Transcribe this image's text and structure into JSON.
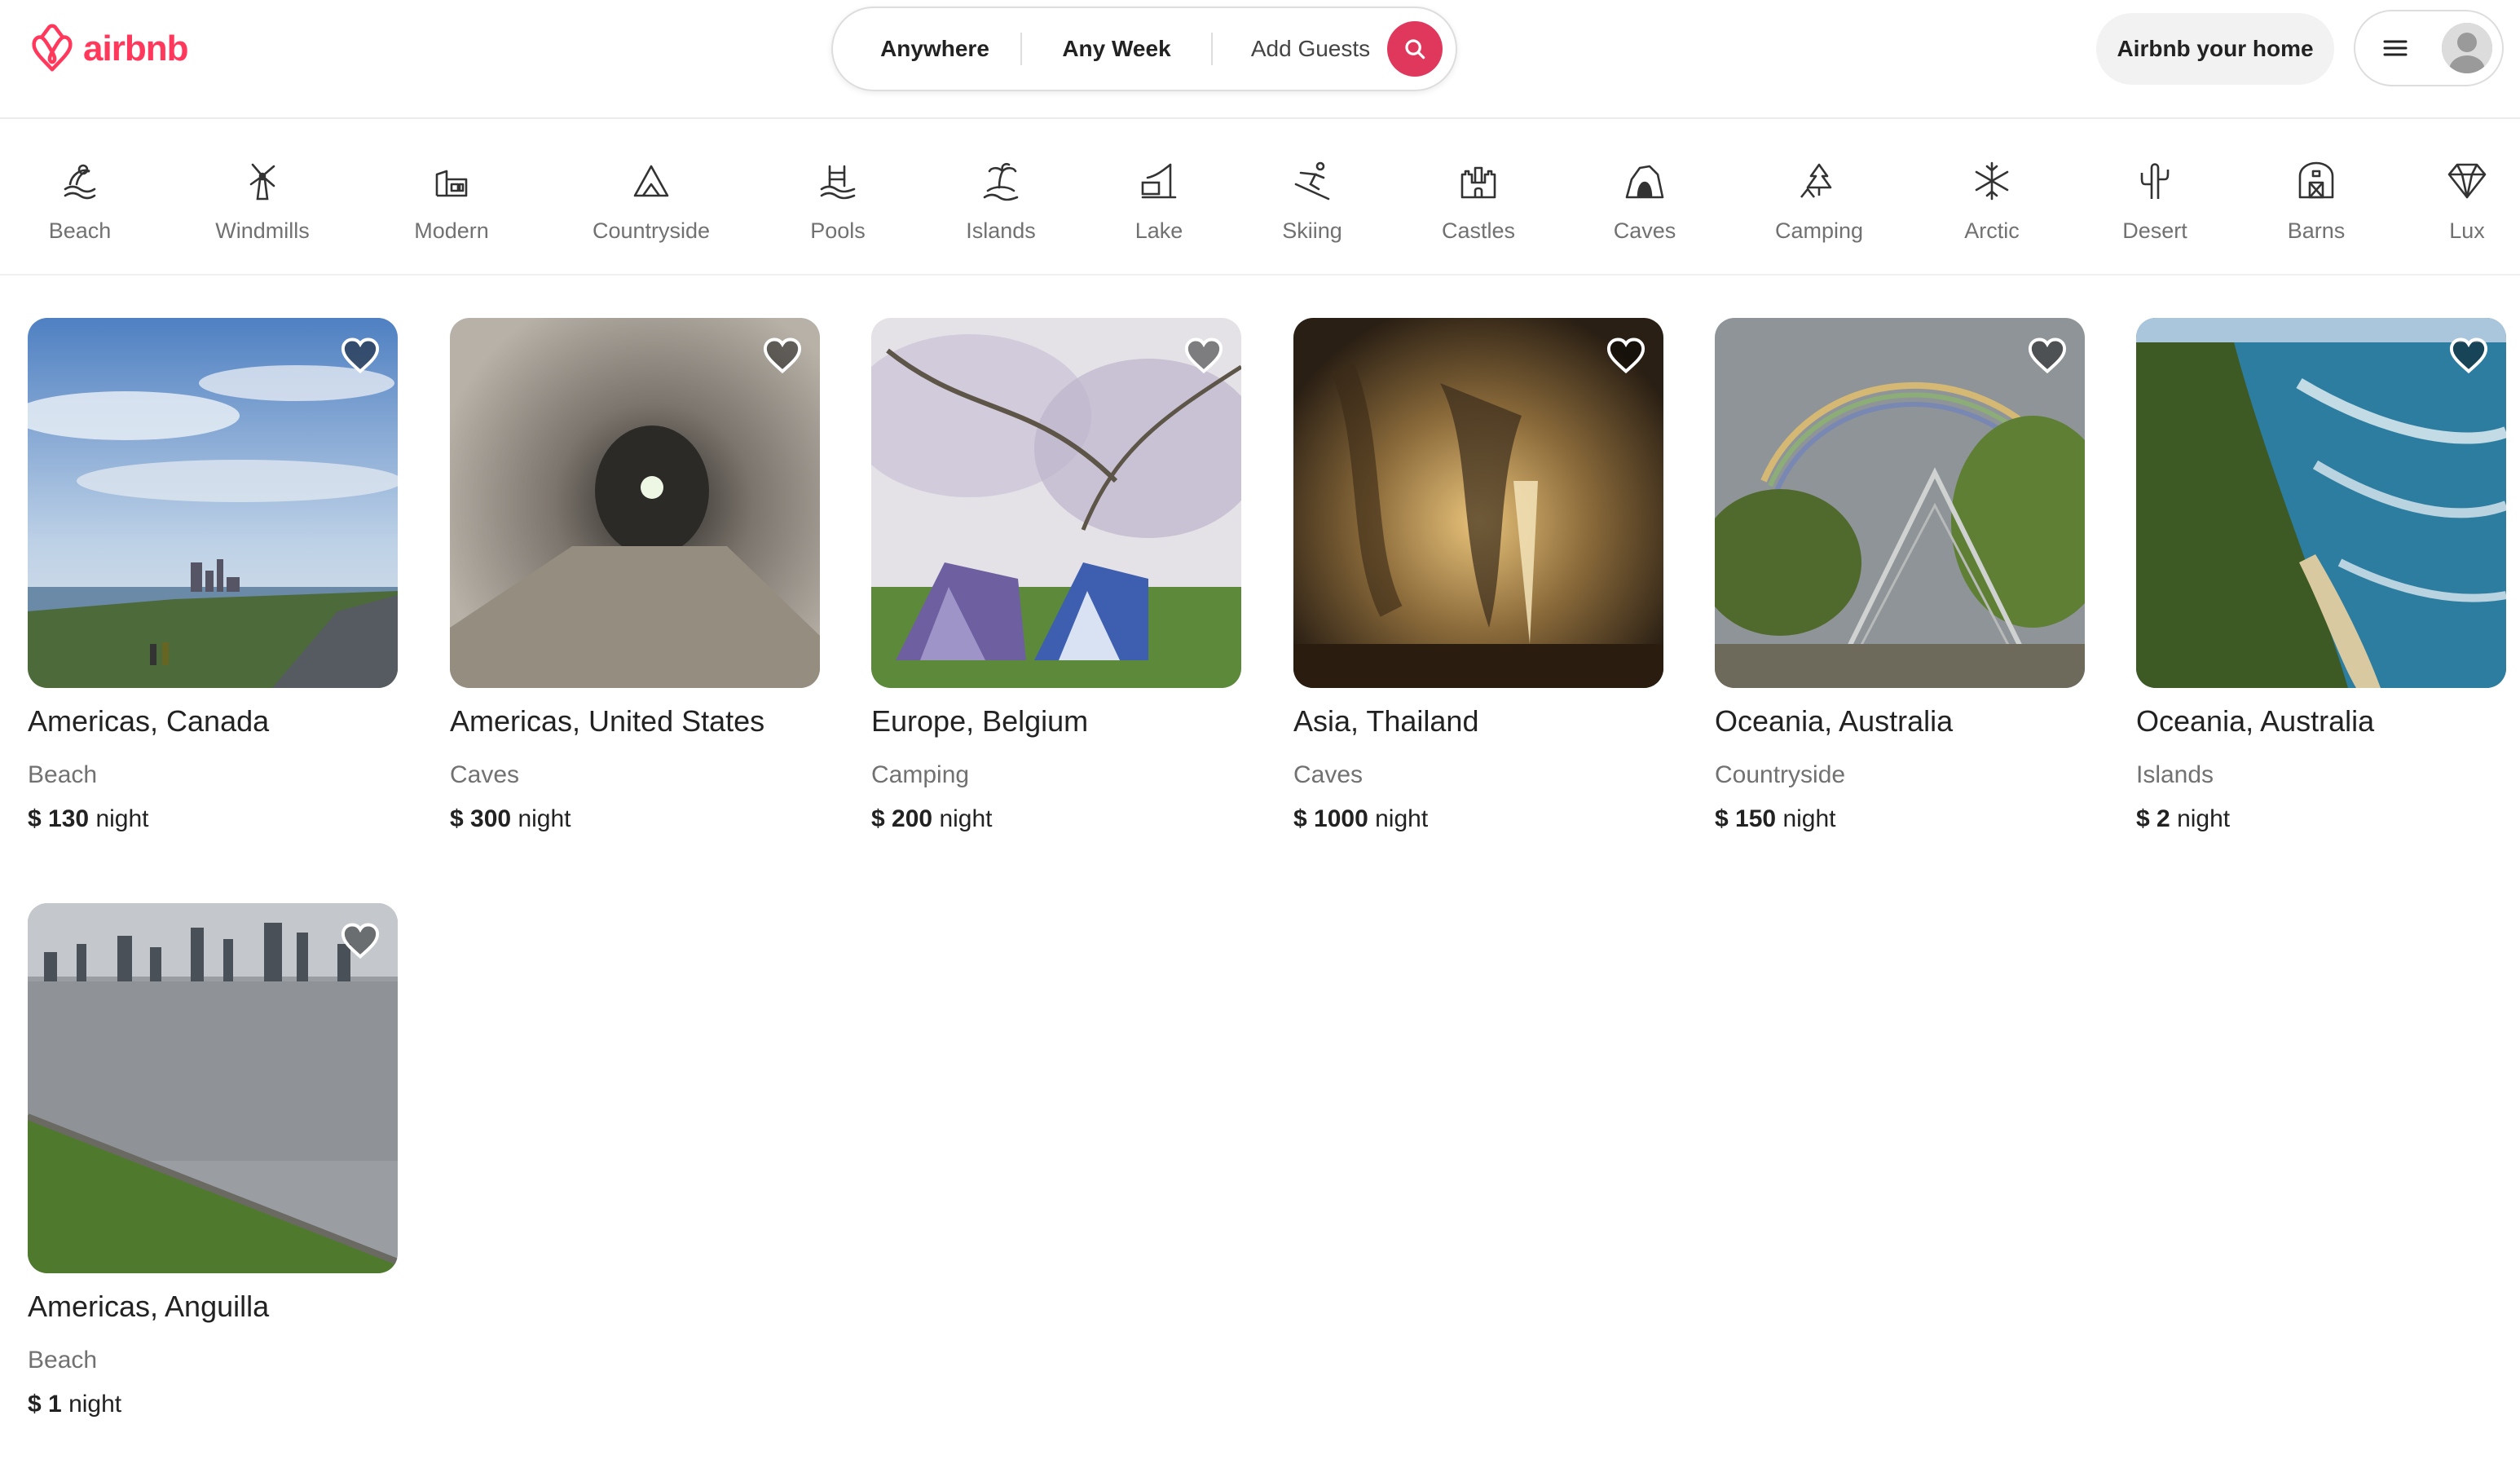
{
  "header": {
    "logo_text": "airbnb",
    "search": {
      "where": "Anywhere",
      "when": "Any Week",
      "who": "Add Guests"
    },
    "host_label": "Airbnb your home"
  },
  "colors": {
    "brand": "#FF385C",
    "search_button": "#E0385C",
    "muted_text": "#717171"
  },
  "categories": [
    {
      "label": "Beach",
      "icon": "beach-icon"
    },
    {
      "label": "Windmills",
      "icon": "windmill-icon"
    },
    {
      "label": "Modern",
      "icon": "modern-house-icon"
    },
    {
      "label": "Countryside",
      "icon": "countryside-icon"
    },
    {
      "label": "Pools",
      "icon": "pool-icon"
    },
    {
      "label": "Islands",
      "icon": "island-icon"
    },
    {
      "label": "Lake",
      "icon": "lake-icon"
    },
    {
      "label": "Skiing",
      "icon": "skiing-icon"
    },
    {
      "label": "Castles",
      "icon": "castle-icon"
    },
    {
      "label": "Caves",
      "icon": "cave-icon"
    },
    {
      "label": "Camping",
      "icon": "camping-icon"
    },
    {
      "label": "Arctic",
      "icon": "snowflake-icon"
    },
    {
      "label": "Desert",
      "icon": "cactus-icon"
    },
    {
      "label": "Barns",
      "icon": "barn-icon"
    },
    {
      "label": "Lux",
      "icon": "diamond-icon"
    }
  ],
  "listings": [
    {
      "title": "Americas, Canada",
      "category": "Beach",
      "currency": "$",
      "price": "130",
      "unit": "night"
    },
    {
      "title": "Americas, United States",
      "category": "Caves",
      "currency": "$",
      "price": "300",
      "unit": "night"
    },
    {
      "title": "Europe, Belgium",
      "category": "Camping",
      "currency": "$",
      "price": "200",
      "unit": "night"
    },
    {
      "title": "Asia, Thailand",
      "category": "Caves",
      "currency": "$",
      "price": "1000",
      "unit": "night"
    },
    {
      "title": "Oceania, Australia",
      "category": "Countryside",
      "currency": "$",
      "price": "150",
      "unit": "night"
    },
    {
      "title": "Oceania, Australia",
      "category": "Islands",
      "currency": "$",
      "price": "2",
      "unit": "night"
    },
    {
      "title": "Americas, Anguilla",
      "category": "Beach",
      "currency": "$",
      "price": "1",
      "unit": "night"
    }
  ]
}
